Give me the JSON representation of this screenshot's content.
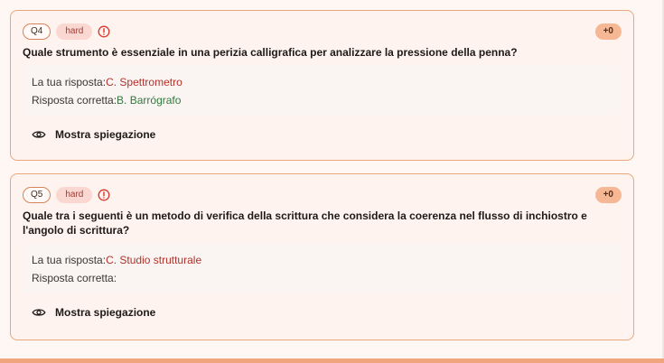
{
  "questions": [
    {
      "badge": "Q4",
      "difficulty": "hard",
      "score": "+0",
      "text": "Quale strumento è essenziale in una perizia calligrafica per analizzare la pressione della penna?",
      "your_answer_label": "La tua risposta:",
      "your_answer": "C. Spettrometro",
      "correct_answer_label": "Risposta corretta:",
      "correct_answer": "B. Barrógrafo",
      "toggle_label": "Mostra spiegazione"
    },
    {
      "badge": "Q5",
      "difficulty": "hard",
      "score": "+0",
      "text": "Quale tra i seguenti è un metodo di verifica della scrittura che considera la coerenza nel flusso di inchiostro e l'angolo di scrittura?",
      "your_answer_label": "La tua risposta:",
      "your_answer": "C. Studio strutturale",
      "correct_answer_label": "Risposta corretta:",
      "correct_answer": "",
      "toggle_label": "Mostra spiegazione"
    }
  ],
  "icons": {
    "difficulty_icon": "alert-circle-icon",
    "toggle_icon": "eye-icon"
  },
  "colors": {
    "accent": "#f1a57c",
    "card_border": "#e9a77b",
    "wrong": "#b0322a",
    "correct": "#2f7a3c",
    "alert": "#d9362b"
  }
}
